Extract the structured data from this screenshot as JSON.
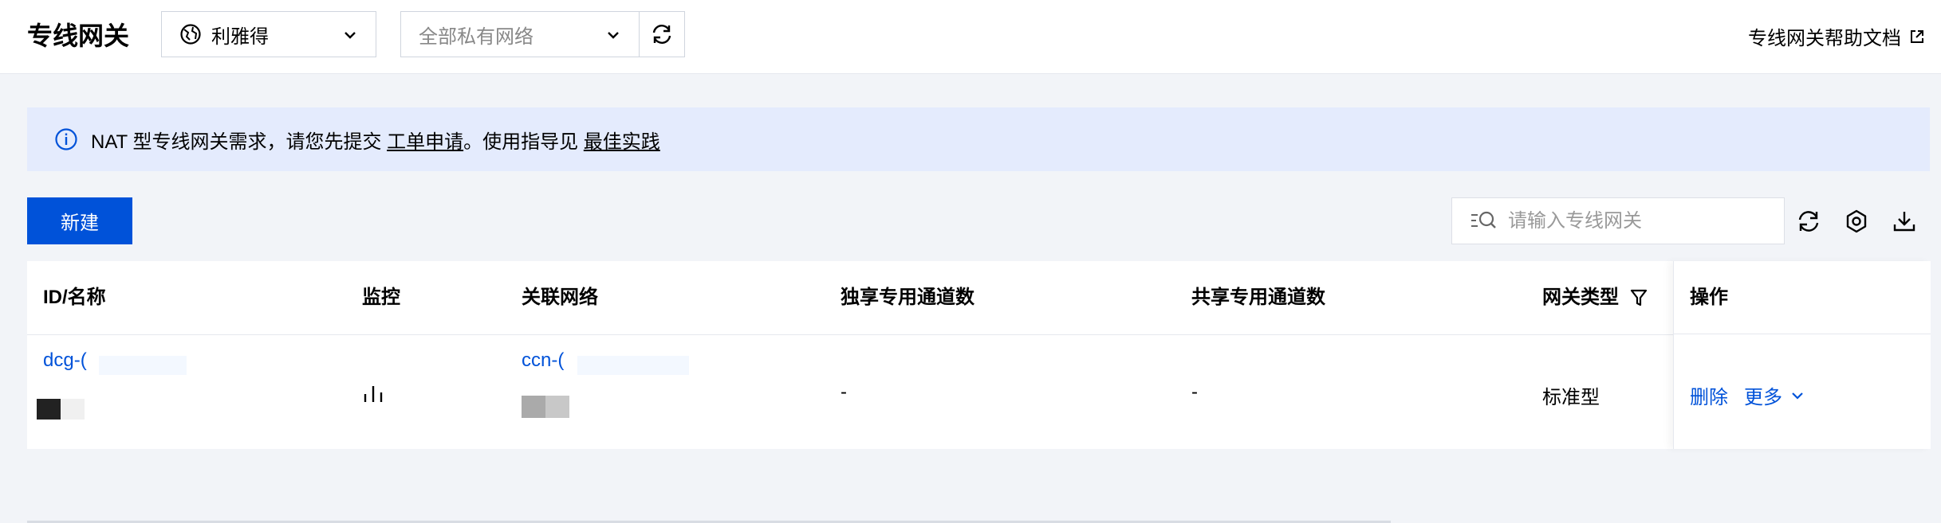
{
  "header": {
    "title": "专线网关",
    "region": "利雅得",
    "vpc_placeholder": "全部私有网络",
    "help_link": "专线网关帮助文档"
  },
  "notice": {
    "prefix": "NAT 型专线网关需求，请您先提交 ",
    "link1": "工单申请",
    "middle": "。使用指导见 ",
    "link2": "最佳实践"
  },
  "toolbar": {
    "new_label": "新建",
    "search_placeholder": "请输入专线网关"
  },
  "table": {
    "columns": [
      "ID/名称",
      "监控",
      "关联网络",
      "独享专用通道数",
      "共享专用通道数",
      "网关类型",
      "操作"
    ],
    "rows": [
      {
        "id": "dcg-(",
        "network": "ccn-(",
        "exclusive_channels": "-",
        "shared_channels": "-",
        "type": "标准型",
        "action_delete": "删除",
        "action_more": "更多"
      }
    ]
  },
  "icons": [
    "globe-icon",
    "chevron-down-icon",
    "refresh-icon",
    "external-link-icon",
    "info-icon",
    "search-icon",
    "settings-icon",
    "download-icon",
    "filter-icon",
    "monitor-chart-icon"
  ],
  "colors": {
    "accent": "#0052d9",
    "notice_bg": "#e4ebfd",
    "page_bg": "#f2f4f8"
  }
}
